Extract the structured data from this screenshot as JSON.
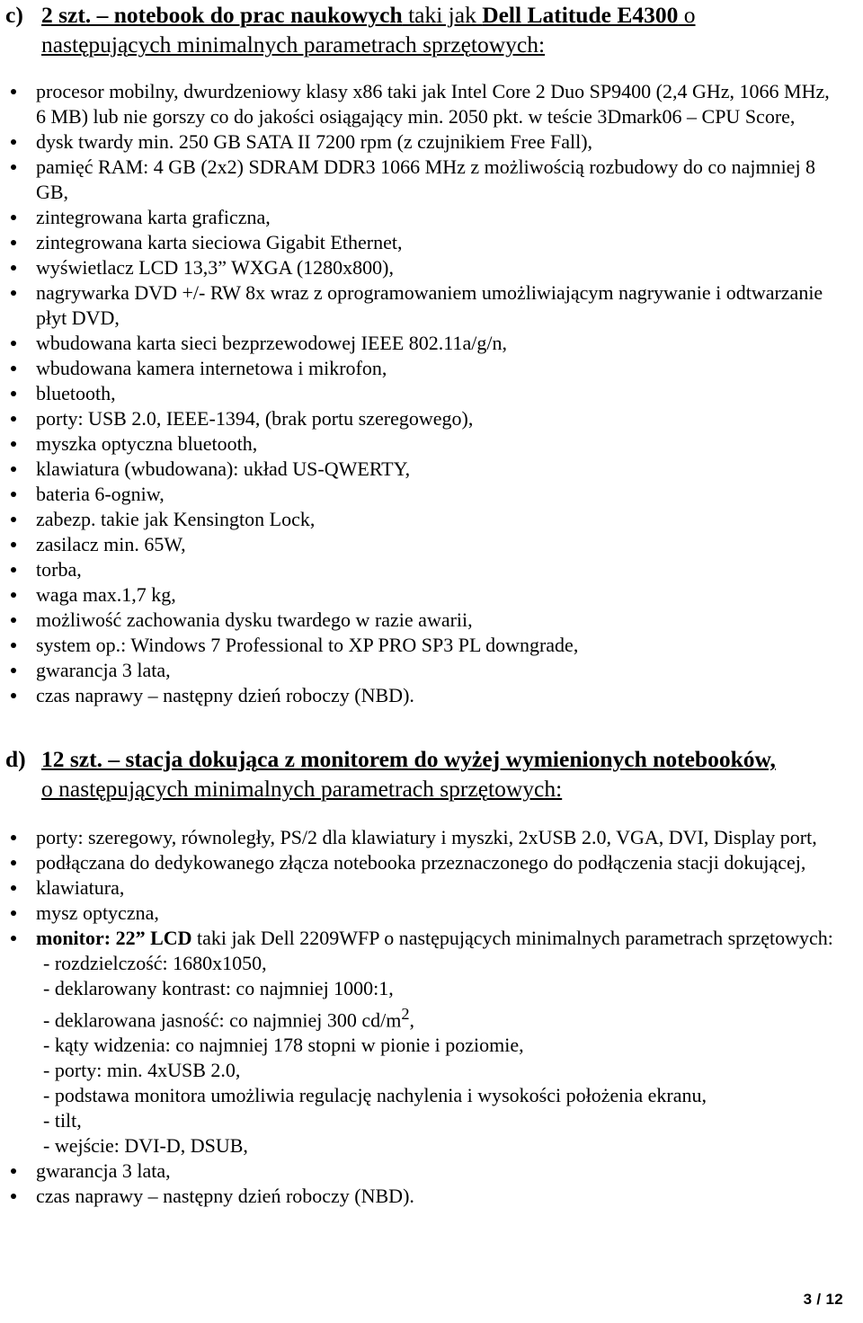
{
  "document": {
    "language": "pl",
    "page_footer": "3 / 12"
  },
  "section_c": {
    "marker": "c)",
    "heading_parts": {
      "bold_1": "2 szt. – notebook do prac naukowych",
      "regular_1": " taki jak ",
      "bold_2": "Dell Latitude E4300",
      "regular_2": " o"
    },
    "heading_line2": "następujących minimalnych parametrach sprzętowych:",
    "items": [
      "procesor mobilny, dwurdzeniowy klasy x86 taki jak Intel Core 2 Duo SP9400 (2,4 GHz, 1066 MHz, 6 MB) lub nie gorszy co do jakości osiągający min. 2050 pkt. w teście 3Dmark06 – CPU Score,",
      "dysk twardy min. 250 GB SATA II 7200 rpm (z czujnikiem Free Fall),",
      "pamięć RAM: 4 GB (2x2) SDRAM DDR3 1066 MHz z możliwością rozbudowy do co najmniej 8 GB,",
      "zintegrowana karta graficzna,",
      "zintegrowana karta sieciowa Gigabit Ethernet,",
      "wyświetlacz LCD 13,3” WXGA (1280x800),",
      "nagrywarka DVD +/- RW 8x wraz z oprogramowaniem umożliwiającym nagrywanie i odtwarzanie płyt DVD,",
      "wbudowana karta sieci bezprzewodowej IEEE 802.11a/g/n,",
      "wbudowana kamera internetowa i mikrofon,",
      "bluetooth,",
      "porty: USB 2.0, IEEE-1394, (brak portu szeregowego),",
      "myszka optyczna bluetooth,",
      "klawiatura (wbudowana): układ US-QWERTY,",
      "bateria 6-ogniw,",
      "zabezp. takie jak Kensington Lock,",
      "zasilacz min. 65W,",
      "torba,",
      "waga max.1,7 kg,",
      "możliwość zachowania dysku twardego w razie awarii,",
      "system op.: Windows 7 Professional to XP PRO SP3  PL downgrade,",
      "gwarancja 3 lata,",
      "czas naprawy – następny dzień roboczy (NBD)."
    ]
  },
  "section_d": {
    "marker": "d)",
    "heading_bold": "12 szt. – stacja dokująca z monitorem do wyżej wymienionych notebooków,",
    "heading_line2": "o następujących minimalnych parametrach sprzętowych:",
    "items_before_monitor": [
      "porty: szeregowy, równoległy, PS/2 dla klawiatury i myszki, 2xUSB 2.0, VGA, DVI, Display port,",
      "podłączana do dedykowanego złącza notebooka przeznaczonego do podłączenia stacji dokującej,",
      "klawiatura,",
      "mysz optyczna,"
    ],
    "monitor_item": {
      "bold_prefix": "monitor: 22” LCD",
      "regular_rest": " taki jak Dell 2209WFP o następujących minimalnych parametrach sprzętowych:",
      "sublines": [
        "- rozdzielczość: 1680x1050,",
        "- deklarowany kontrast: co najmniej 1000:1,",
        "- kąty widzenia: co najmniej 178 stopni w pionie i poziomie,",
        "- porty: min. 4xUSB 2.0,",
        "- podstawa monitora umożliwia regulację nachylenia i wysokości położenia ekranu,",
        "- tilt,",
        "- wejście: DVI-D, DSUB,"
      ],
      "brightness_subline": {
        "text_before": "- deklarowana jasność: co najmniej 300 cd/m",
        "superscript": "2",
        "text_after": ","
      }
    },
    "items_after_monitor": [
      "gwarancja 3 lata,",
      "czas naprawy – następny dzień roboczy (NBD)."
    ]
  }
}
